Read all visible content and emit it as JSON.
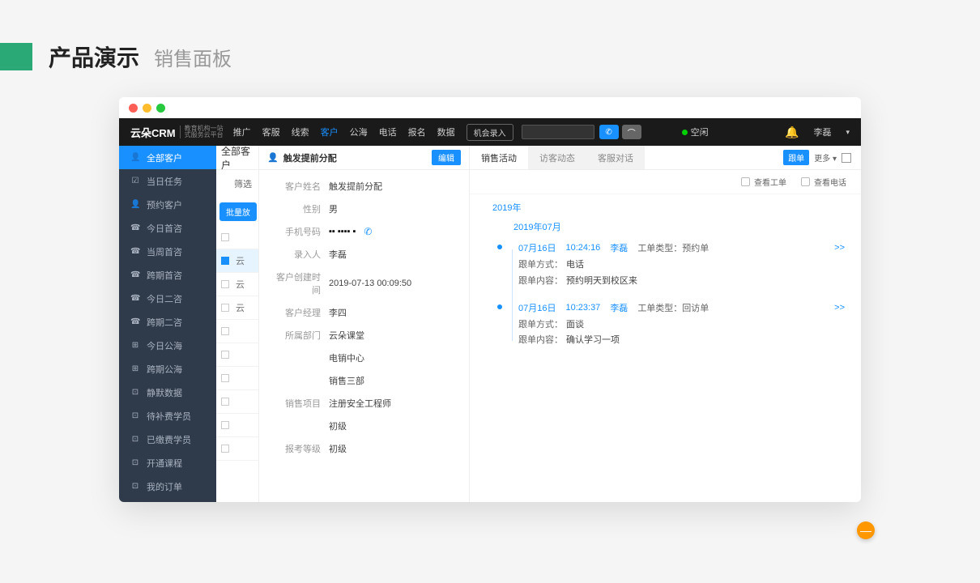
{
  "page": {
    "title": "产品演示",
    "subtitle": "销售面板"
  },
  "topbar": {
    "logo": "云朵CRM",
    "logo_sub_1": "教育机构一站",
    "logo_sub_2": "式服务云平台",
    "nav": [
      "推广",
      "客服",
      "线索",
      "客户",
      "公海",
      "电话",
      "报名",
      "数据"
    ],
    "nav_active_index": 3,
    "opportunity_btn": "机会录入",
    "status_text": "空闲",
    "user": "李磊"
  },
  "sidebar": {
    "items": [
      {
        "icon": "👤",
        "label": "全部客户",
        "active": true
      },
      {
        "icon": "☑",
        "label": "当日任务"
      },
      {
        "icon": "👤",
        "label": "预约客户"
      },
      {
        "icon": "☎",
        "label": "今日首咨"
      },
      {
        "icon": "☎",
        "label": "当周首咨"
      },
      {
        "icon": "☎",
        "label": "跨期首咨"
      },
      {
        "icon": "☎",
        "label": "今日二咨"
      },
      {
        "icon": "☎",
        "label": "跨期二咨"
      },
      {
        "icon": "⊞",
        "label": "今日公海"
      },
      {
        "icon": "⊞",
        "label": "跨期公海"
      },
      {
        "icon": "⊡",
        "label": "静默数据"
      },
      {
        "icon": "⊡",
        "label": "待补费学员"
      },
      {
        "icon": "⊡",
        "label": "已缴费学员"
      },
      {
        "icon": "⊡",
        "label": "开通课程"
      },
      {
        "icon": "⊡",
        "label": "我的订单"
      }
    ]
  },
  "list": {
    "header": "全部客户",
    "filter_label": "筛选",
    "bulk_btn": "批量放",
    "rows": [
      {
        "name": "",
        "selected": false
      },
      {
        "name": "云",
        "selected": true
      },
      {
        "name": "云",
        "selected": false
      },
      {
        "name": "云",
        "selected": false
      },
      {
        "name": "",
        "selected": false
      },
      {
        "name": "",
        "selected": false
      },
      {
        "name": "",
        "selected": false
      },
      {
        "name": "",
        "selected": false
      },
      {
        "name": "",
        "selected": false
      },
      {
        "name": "",
        "selected": false
      }
    ]
  },
  "detail": {
    "header_title": "触发提前分配",
    "edit_btn": "编辑",
    "fields": [
      {
        "label": "客户姓名",
        "value": "触发提前分配"
      },
      {
        "label": "性别",
        "value": "男"
      },
      {
        "label": "手机号码",
        "value": "▪▪ ▪▪▪▪ ▪",
        "is_phone": true
      },
      {
        "label": "录入人",
        "value": "李磊"
      },
      {
        "label": "客户创建时间",
        "value": "2019-07-13 00:09:50"
      },
      {
        "label": "客户经理",
        "value": "李四"
      },
      {
        "label": "所属部门",
        "value": "云朵课堂"
      },
      {
        "label": "",
        "value": "电销中心"
      },
      {
        "label": "",
        "value": "销售三部"
      },
      {
        "label": "销售项目",
        "value": "注册安全工程师"
      },
      {
        "label": "",
        "value": "初级"
      },
      {
        "label": "报考等级",
        "value": "初级"
      }
    ]
  },
  "activity": {
    "tabs": [
      "销售活动",
      "访客动态",
      "客服对话"
    ],
    "active_tab_index": 0,
    "tool_followup": "跟单",
    "tool_more": "更多 ▾",
    "filter_view_ticket": "查看工单",
    "filter_view_call": "查看电话",
    "year": "2019年",
    "month": "2019年07月",
    "items": [
      {
        "date": "07月16日",
        "time": "10:24:16",
        "person": "李磊",
        "type_label": "工单类型：",
        "type_value": "预约单",
        "expand": ">>",
        "rows": [
          {
            "label": "跟单方式：",
            "value": "电话"
          },
          {
            "label": "跟单内容：",
            "value": "预约明天到校区来"
          }
        ]
      },
      {
        "date": "07月16日",
        "time": "10:23:37",
        "person": "李磊",
        "type_label": "工单类型：",
        "type_value": "回访单",
        "expand": ">>",
        "rows": [
          {
            "label": "跟单方式：",
            "value": "面谈"
          },
          {
            "label": "跟单内容：",
            "value": "确认学习一项"
          }
        ]
      }
    ]
  },
  "fab": "—"
}
